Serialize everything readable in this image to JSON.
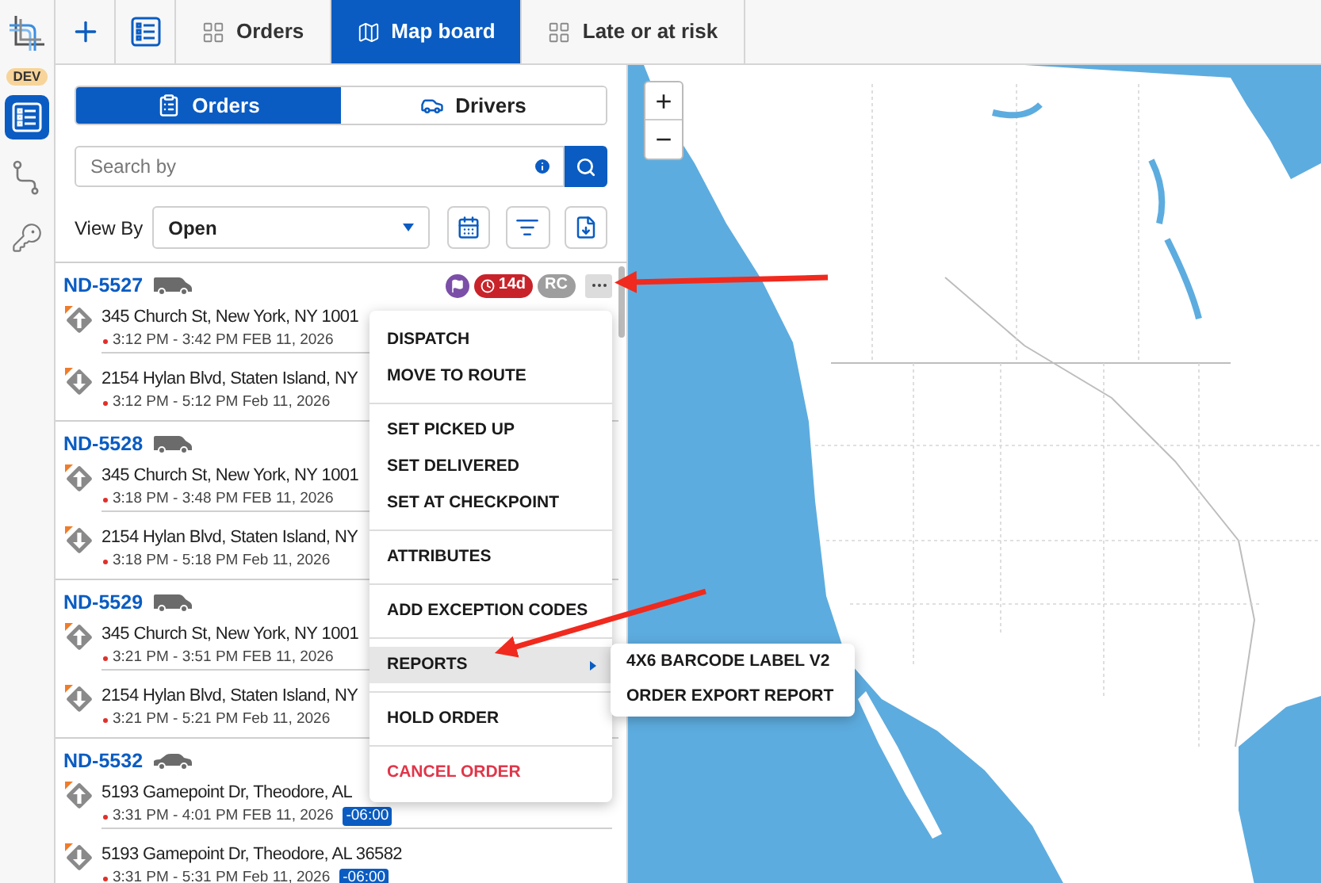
{
  "rail": {
    "badge": "DEV",
    "items": [
      {
        "kind": "orders",
        "selected": true
      },
      {
        "kind": "route",
        "selected": false
      },
      {
        "kind": "key",
        "selected": false
      }
    ]
  },
  "tabs": [
    {
      "kind": "add",
      "selected": false
    },
    {
      "kind": "list",
      "selected": false
    },
    {
      "kind": "grid",
      "label": "Orders",
      "selected": false
    },
    {
      "kind": "map",
      "label": "Map board",
      "selected": true
    },
    {
      "kind": "grid",
      "label": "Late or at risk",
      "selected": false
    }
  ],
  "segments": [
    {
      "kind": "orders",
      "label": "Orders",
      "selected": true
    },
    {
      "kind": "drivers",
      "label": "Drivers",
      "selected": false
    }
  ],
  "search": {
    "placeholder": "Search by"
  },
  "view_by": {
    "label": "View By",
    "value": "Open"
  },
  "orders": [
    {
      "id": "ND-5527",
      "kind": "van",
      "menu_open": true,
      "badges": [
        {
          "kind": "flag"
        },
        {
          "kind": "age",
          "label": "14d"
        },
        {
          "kind": "initials",
          "label": "RC"
        }
      ],
      "stops": [
        {
          "kind": "pickup",
          "address": "345 Church St, New York, NY 1001",
          "time": "3:12 PM - 3:42 PM FEB 11, 2026"
        },
        {
          "kind": "dropoff",
          "address": "2154 Hylan Blvd, Staten Island, NY",
          "time": "3:12 PM - 5:12 PM Feb 11, 2026"
        }
      ]
    },
    {
      "id": "ND-5528",
      "kind": "van",
      "menu_open": false,
      "stops": [
        {
          "kind": "pickup",
          "address": "345 Church St, New York, NY 1001",
          "time": "3:18 PM - 3:48 PM FEB 11, 2026"
        },
        {
          "kind": "dropoff",
          "address": "2154 Hylan Blvd, Staten Island, NY",
          "time": "3:18 PM - 5:18 PM Feb 11, 2026"
        }
      ]
    },
    {
      "id": "ND-5529",
      "kind": "van",
      "menu_open": false,
      "stops": [
        {
          "kind": "pickup",
          "address": "345 Church St, New York, NY 1001",
          "time": "3:21 PM - 3:51 PM FEB 11, 2026"
        },
        {
          "kind": "dropoff",
          "address": "2154 Hylan Blvd, Staten Island, NY",
          "time": "3:21 PM - 5:21 PM Feb 11, 2026"
        }
      ]
    },
    {
      "id": "ND-5532",
      "kind": "car",
      "menu_open": false,
      "stops": [
        {
          "kind": "pickup",
          "address": "5193 Gamepoint Dr, Theodore, AL",
          "time": "3:31 PM - 4:01 PM FEB 11, 2026",
          "tz": "-06:00"
        },
        {
          "kind": "dropoff",
          "address": "5193 Gamepoint Dr, Theodore, AL 36582",
          "time": "3:31 PM - 5:31 PM Feb 11, 2026",
          "tz": "-06:00"
        }
      ]
    }
  ],
  "menu": {
    "groups": [
      {
        "items": [
          {
            "label": "DISPATCH",
            "kind": "action",
            "selected": false
          },
          {
            "label": "MOVE TO ROUTE",
            "kind": "action",
            "selected": false
          }
        ]
      },
      {
        "items": [
          {
            "label": "SET PICKED UP",
            "kind": "action",
            "selected": false
          },
          {
            "label": "SET DELIVERED",
            "kind": "action",
            "selected": false
          },
          {
            "label": "SET AT CHECKPOINT",
            "kind": "action",
            "selected": false
          }
        ]
      },
      {
        "items": [
          {
            "label": "ATTRIBUTES",
            "kind": "action",
            "selected": false
          }
        ]
      },
      {
        "items": [
          {
            "label": "ADD EXCEPTION CODES",
            "kind": "action",
            "selected": false
          }
        ]
      },
      {
        "items": [
          {
            "label": "REPORTS",
            "kind": "submenu",
            "selected": true
          }
        ]
      },
      {
        "items": [
          {
            "label": "HOLD ORDER",
            "kind": "action",
            "selected": false
          }
        ]
      },
      {
        "items": [
          {
            "label": "CANCEL ORDER",
            "kind": "danger",
            "selected": false
          }
        ]
      }
    ],
    "submenu": [
      {
        "label": "4X6 BARCODE LABEL V2"
      },
      {
        "label": "ORDER EXPORT REPORT"
      }
    ]
  },
  "map": {
    "zoom_in": "+",
    "zoom_out": "−"
  }
}
